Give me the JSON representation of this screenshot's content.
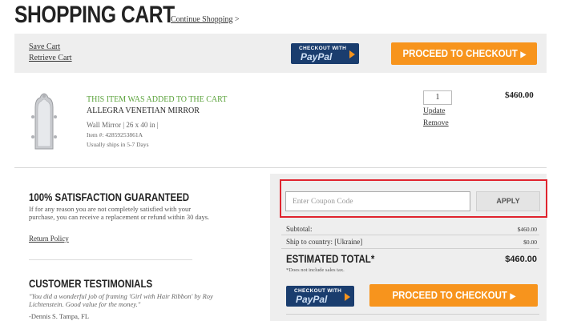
{
  "header": {
    "title": "SHOPPING CART",
    "continue_link": "Continue Shopping",
    "continue_suffix": ">"
  },
  "top_bar": {
    "save_cart": "Save Cart",
    "retrieve_cart": "Retrieve Cart",
    "paypal_small": "CHECKOUT WITH",
    "paypal_logo_1": "Pay",
    "paypal_logo_2": "Pal",
    "checkout_label": "PROCEED TO CHECKOUT",
    "checkout_arrow": "▶"
  },
  "cart_item": {
    "added_notice": "THIS ITEM WAS ADDED TO THE CART",
    "name": "ALLEGRA VENETIAN MIRROR",
    "details": "Wall Mirror | 26 x 40 in |",
    "item_number": "Item #: 42859253861A",
    "shipping": "Usually ships in 5-7 Days",
    "quantity": "1",
    "update_label": "Update",
    "remove_label": "Remove",
    "price": "$460.00"
  },
  "satisfaction": {
    "title": "100% SATISFACTION GUARANTEED",
    "body": "If for any reason you are not completely satisfied with your purchase, you can receive a replacement or refund within 30 days.",
    "return_policy": "Return Policy"
  },
  "testimonials": {
    "title": "CUSTOMER TESTIMONIALS",
    "quote": "\"You did a wonderful job of framing 'Girl with Hair Ribbon' by Roy Lichtenstein. Good value for the money.\"",
    "author": "-Dennis S. Tampa, FL"
  },
  "summary": {
    "coupon_placeholder": "Enter Coupon Code",
    "apply_label": "APPLY",
    "subtotal_label": "Subtotal:",
    "subtotal_value": "$460.00",
    "ship_label": "Ship to country: [Ukraine]",
    "ship_value": "$0.00",
    "estimated_label": "ESTIMATED TOTAL*",
    "estimated_value": "$460.00",
    "tax_note": "*Does not include sales tax.",
    "paypal_small": "CHECKOUT WITH",
    "paypal_logo_1": "Pay",
    "paypal_logo_2": "Pal",
    "checkout_label": "PROCEED TO CHECKOUT",
    "checkout_arrow": "▶"
  },
  "colors": {
    "checkout_orange": "#f7941d",
    "paypal_navy": "#1a3d6e",
    "added_green": "#5aa23a",
    "highlight_red": "#e0242e",
    "panel_gray": "#eeeeee"
  }
}
